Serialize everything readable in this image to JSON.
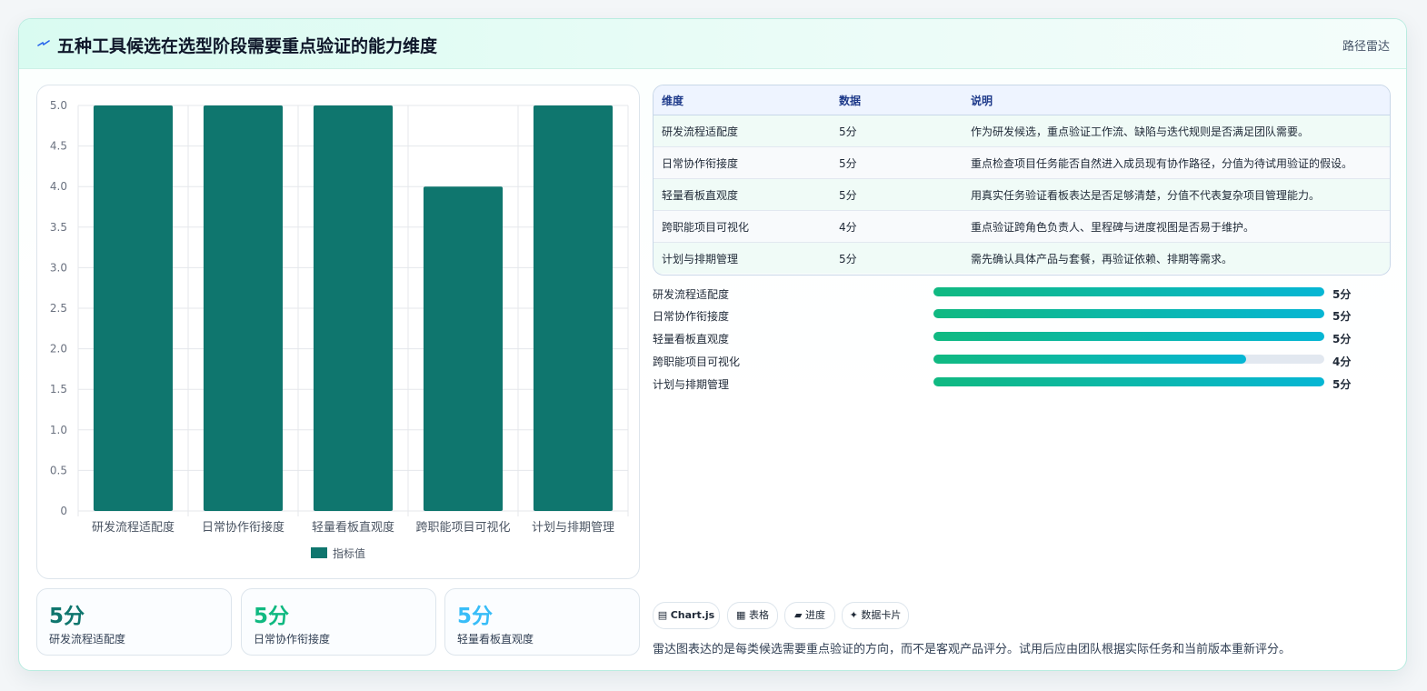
{
  "header": {
    "title": "五种工具候选在选型阶段需要重点验证的能力维度",
    "tag": "路径雷达"
  },
  "chart_data": {
    "type": "bar",
    "categories": [
      "研发流程适配度",
      "日常协作衔接度",
      "轻量看板直观度",
      "跨职能项目可视化",
      "计划与排期管理"
    ],
    "series": [
      {
        "name": "指标值",
        "values": [
          5,
          5,
          5,
          4,
          5
        ],
        "color": "#0f766e"
      }
    ],
    "ylim": [
      0,
      5
    ],
    "yticks": [
      "0",
      "0.5",
      "1.0",
      "1.5",
      "2.0",
      "2.5",
      "3.0",
      "3.5",
      "4.0",
      "4.5",
      "5.0"
    ],
    "grid": true,
    "legend": "bottom"
  },
  "kpis": [
    {
      "value": "5分",
      "label": "研发流程适配度",
      "color": "#0f766e"
    },
    {
      "value": "5分",
      "label": "日常协作衔接度",
      "color": "#10b981"
    },
    {
      "value": "5分",
      "label": "轻量看板直观度",
      "color": "#38bdf8"
    }
  ],
  "table": {
    "headers": [
      "维度",
      "数据",
      "说明"
    ],
    "rows": [
      [
        "研发流程适配度",
        "5分",
        "作为研发候选，重点验证工作流、缺陷与迭代规则是否满足团队需要。"
      ],
      [
        "日常协作衔接度",
        "5分",
        "重点检查项目任务能否自然进入成员现有协作路径，分值为待试用验证的假设。"
      ],
      [
        "轻量看板直观度",
        "5分",
        "用真实任务验证看板表达是否足够清楚，分值不代表复杂项目管理能力。"
      ],
      [
        "跨职能项目可视化",
        "4分",
        "重点验证跨角色负责人、里程碑与进度视图是否易于维护。"
      ],
      [
        "计划与排期管理",
        "5分",
        "需先确认具体产品与套餐，再验证依赖、排期等需求。"
      ]
    ]
  },
  "progress": [
    {
      "label": "研发流程适配度",
      "value": 5,
      "max": 5,
      "text": "5分"
    },
    {
      "label": "日常协作衔接度",
      "value": 5,
      "max": 5,
      "text": "5分"
    },
    {
      "label": "轻量看板直观度",
      "value": 5,
      "max": 5,
      "text": "5分"
    },
    {
      "label": "跨职能项目可视化",
      "value": 4,
      "max": 5,
      "text": "4分"
    },
    {
      "label": "计划与排期管理",
      "value": 5,
      "max": 5,
      "text": "5分"
    }
  ],
  "chips": [
    {
      "icon": "chart-icon",
      "glyph": "▤",
      "label": "Chart.js"
    },
    {
      "icon": "table-icon",
      "glyph": "▦",
      "label": "表格"
    },
    {
      "icon": "progress-icon",
      "glyph": "▰",
      "label": "进度"
    },
    {
      "icon": "card-icon",
      "glyph": "✦",
      "label": "数据卡片"
    }
  ],
  "footnote": "雷达图表达的是每类候选需要重点验证的方向，而不是客观产品评分。试用后应由团队根据实际任务和当前版本重新评分。"
}
